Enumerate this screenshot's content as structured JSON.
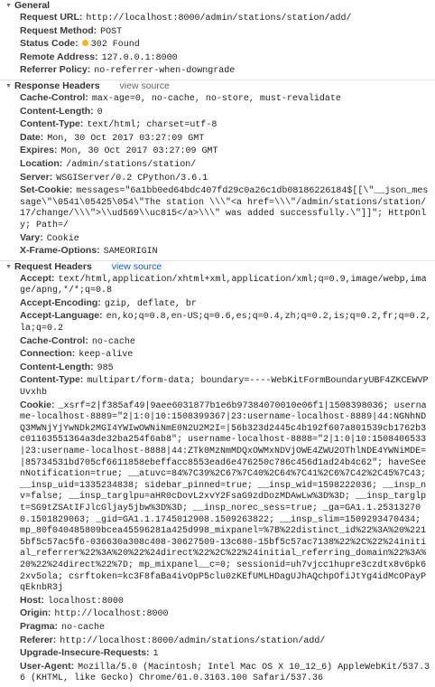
{
  "colors": {
    "status_dot": "#f5b520"
  },
  "sections": [
    {
      "title": "General",
      "view_source": null,
      "rows": [
        {
          "label": "Request URL:",
          "value": "http://localhost:8000/admin/stations/station/add/"
        },
        {
          "label": "Request Method:",
          "value": "POST"
        },
        {
          "label": "Status Code:",
          "value": "302 Found",
          "dot": true
        },
        {
          "label": "Remote Address:",
          "value": "127.0.0.1:8000"
        },
        {
          "label": "Referrer Policy:",
          "value": "no-referrer-when-downgrade"
        }
      ]
    },
    {
      "title": "Response Headers",
      "view_source": "view source",
      "rows": [
        {
          "label": "Cache-Control:",
          "value": "max-age=0, no-cache, no-store, must-revalidate"
        },
        {
          "label": "Content-Length:",
          "value": "0"
        },
        {
          "label": "Content-Type:",
          "value": "text/html; charset=utf-8"
        },
        {
          "label": "Date:",
          "value": "Mon, 30 Oct 2017 03:27:09 GMT"
        },
        {
          "label": "Expires:",
          "value": "Mon, 30 Oct 2017 03:27:09 GMT"
        },
        {
          "label": "Location:",
          "value": "/admin/stations/station/"
        },
        {
          "label": "Server:",
          "value": "WSGIServer/0.2 CPython/3.6.1"
        },
        {
          "label": "Set-Cookie:",
          "value": "messages=\"6a1bb0ed64bdc407fd29c0a26c1db08186226184$[[\\\"__json_message\\\"\\0541\\05425\\054\\\"The station \\\\\\\"<a href=\\\\\\\"/admin/stations/station/17/change/\\\\\\\">\\\\ud569\\\\uc815</a>\\\\\\\" was added successfully.\\\"]]\"; HttpOnly; Path=/"
        },
        {
          "label": "Vary:",
          "value": "Cookie"
        },
        {
          "label": "X-Frame-Options:",
          "value": "SAMEORIGIN"
        }
      ]
    },
    {
      "title": "Request Headers",
      "view_source": "view source",
      "rows": [
        {
          "label": "Accept:",
          "value": "text/html,application/xhtml+xml,application/xml;q=0.9,image/webp,image/apng,*/*;q=0.8"
        },
        {
          "label": "Accept-Encoding:",
          "value": "gzip, deflate, br"
        },
        {
          "label": "Accept-Language:",
          "value": "en,ko;q=0.8,en-US;q=0.6,es;q=0.4,zh;q=0.2,is;q=0.2,fr;q=0.2,la;q=0.2"
        },
        {
          "label": "Cache-Control:",
          "value": "no-cache"
        },
        {
          "label": "Connection:",
          "value": "keep-alive"
        },
        {
          "label": "Content-Length:",
          "value": "985"
        },
        {
          "label": "Content-Type:",
          "value": "multipart/form-data; boundary=----WebKitFormBoundaryUBF4ZKCEWVPUvxhb"
        },
        {
          "label": "Cookie:",
          "value": "_xsrf=2|f385af49|9aee6031877b1e6b97384070010e06f1|1508398036; username-localhost-8889=\"2|1:0|10:1508399367|23:username-localhost-8889|44:NGNhNDQ3MWNjYjYwNDk2MGI4YWIwOWNiNmE0N2U2M2I=|56b323d2445c4b192f607a801539cb1762b3c01163551364a3de32ba254f6ab8\"; username-localhost-8888=\"2|1:0|10:1508406533|23:username-localhost-8888|44:ZTk0MzNmMDQxOWMxNDVjOWE4ZWU2OThlNDE4YWNiMDE=|85734531bd705cf6611858ebeffacc8553ead6e476250c786c456d1ad24b4c62\"; haveSeenNotification=true; __atuvc=84%7C39%2C67%7C40%2C64%7C41%2C6%7C42%2C45%7C43; __insp_uid=1335234838; sidebar_pinned=true; __insp_wid=1598222036; __insp_nv=false; __insp_targlpu=aHR0cDovL2xvY2FsaG9zdDozMDAwLw%3D%3D; __insp_targlpt=SG9tZSAtIFJlcGljay5jbw%3D%3D; __insp_norec_sess=true; _ga=GA1.1.253132700.1501829063; _gid=GA1.1.1745012908.1509263822; __insp_slim=1509293470434; mp_80f040485809bcea45596281a425d998_mixpanel=%7B%22distinct_id%22%3A%20%2215bf5c57ac5f6-036630a308c408-30627509-13c680-15bf5c57ac7138%22%2C%22%24initial_referrer%22%3A%20%22%24direct%22%2C%22%24initial_referring_domain%22%3A%20%22%24direct%22%7D; mp_mixpanel__c=0; sessionid=uh7vjcc1hupre3czdtx8v6pk62xv5ola; csrftoken=kc3F8faBa4ivOpP5clu0zKEfUMLHDagUJhAQchpOfiJtYg4idMcOPayPqEknbR3j"
        },
        {
          "label": "Host:",
          "value": "localhost:8000"
        },
        {
          "label": "Origin:",
          "value": "http://localhost:8000"
        },
        {
          "label": "Pragma:",
          "value": "no-cache"
        },
        {
          "label": "Referer:",
          "value": "http://localhost:8000/admin/stations/station/add/"
        },
        {
          "label": "Upgrade-Insecure-Requests:",
          "value": "1"
        },
        {
          "label": "User-Agent:",
          "value": "Mozilla/5.0 (Macintosh; Intel Mac OS X 10_12_6) AppleWebKit/537.36 (KHTML, like Gecko) Chrome/61.0.3163.100 Safari/537.36"
        }
      ]
    }
  ]
}
